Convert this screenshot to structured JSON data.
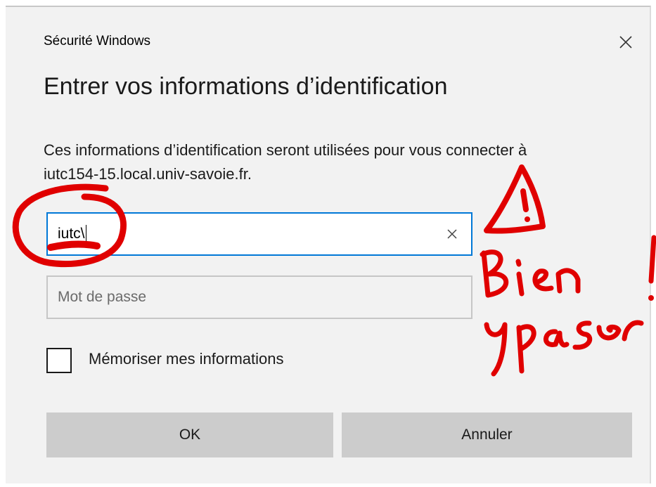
{
  "dialog": {
    "window_title": "Sécurité Windows",
    "heading": "Entrer vos informations d’identification",
    "description": "Ces informations d’identification seront utilisées pour vous connecter à iutc154-15.local.univ-savoie.fr.",
    "username": {
      "value": "iutc\\",
      "clear_icon": "close-icon"
    },
    "password": {
      "placeholder": "Mot de passe",
      "value": ""
    },
    "remember": {
      "label": "Mémoriser mes informations",
      "checked": false
    },
    "buttons": {
      "ok": "OK",
      "cancel": "Annuler"
    }
  },
  "annotation": {
    "handwritten_text": "Bien y passer !",
    "color": "#e00000"
  },
  "colors": {
    "focus_border": "#0078d7",
    "dialog_bg": "#f2f2f2",
    "button_bg": "#cccccc"
  }
}
